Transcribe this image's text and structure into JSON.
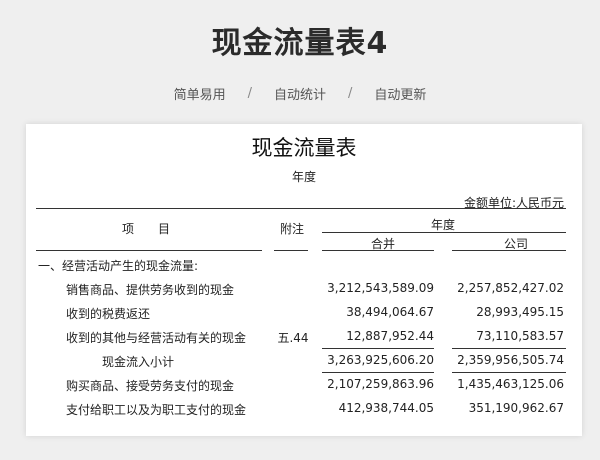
{
  "header": {
    "title": "现金流量表4",
    "tags": [
      "简单易用",
      "自动统计",
      "自动更新"
    ],
    "separator": "/"
  },
  "doc": {
    "title": "现金流量表",
    "year_label": "年度",
    "unit": "金额单位:人民币元",
    "columns": {
      "item": "项　　目",
      "note": "附注",
      "year_group": "年度",
      "consolidated": "合并",
      "company": "公司"
    },
    "rows": [
      {
        "label": "一、经营活动产生的现金流量:",
        "note": "",
        "consolidated": "",
        "company": ""
      },
      {
        "label": "销售商品、提供劳务收到的现金",
        "note": "",
        "consolidated": "3,212,543,589.09",
        "company": "2,257,852,427.02"
      },
      {
        "label": "收到的税费返还",
        "note": "",
        "consolidated": "38,494,064.67",
        "company": "28,993,495.15"
      },
      {
        "label": "收到的其他与经营活动有关的现金",
        "note": "五.44",
        "consolidated": "12,887,952.44",
        "company": "73,110,583.57"
      },
      {
        "label": "现金流入小计",
        "note": "",
        "consolidated": "3,263,925,606.20",
        "company": "2,359,956,505.74"
      },
      {
        "label": "购买商品、接受劳务支付的现金",
        "note": "",
        "consolidated": "2,107,259,863.96",
        "company": "1,435,463,125.06"
      },
      {
        "label": "支付给职工以及为职工支付的现金",
        "note": "",
        "consolidated": "412,938,744.05",
        "company": "351,190,962.67"
      }
    ]
  }
}
